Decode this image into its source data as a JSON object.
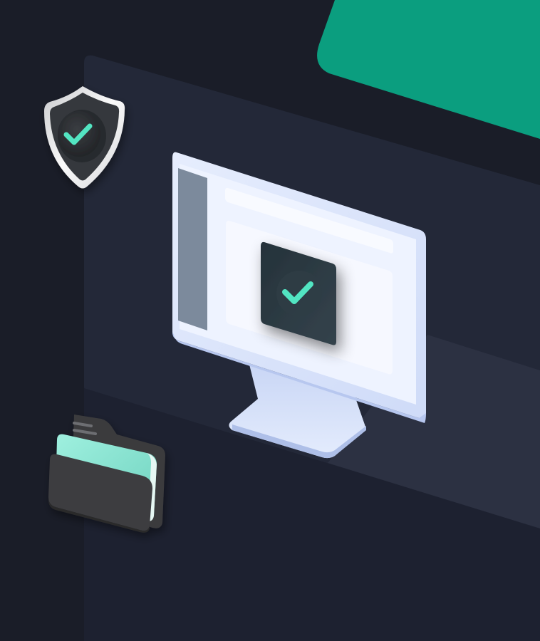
{
  "colors": {
    "background": "#1a1d28",
    "panel": "#232838",
    "panel_light": "#2c3142",
    "green_accent": "#0b9e7f",
    "yellow_accent": "#f1c542",
    "check_mint": "#52e5c2",
    "monitor_frame": "#dde6fb",
    "monitor_screen": "#eef3ff",
    "sidebar_gray": "#7c8a9c",
    "dialog_dark": "#2b3942",
    "folder_mint": "#8fe4d3",
    "folder_dark": "#3a3a3c",
    "shield_dark": "#35383d",
    "shield_rim": "#e8e8ea"
  },
  "icons": {
    "shield": "shield-check-icon",
    "monitor_check": "check-icon",
    "folder": "folder-icon"
  }
}
